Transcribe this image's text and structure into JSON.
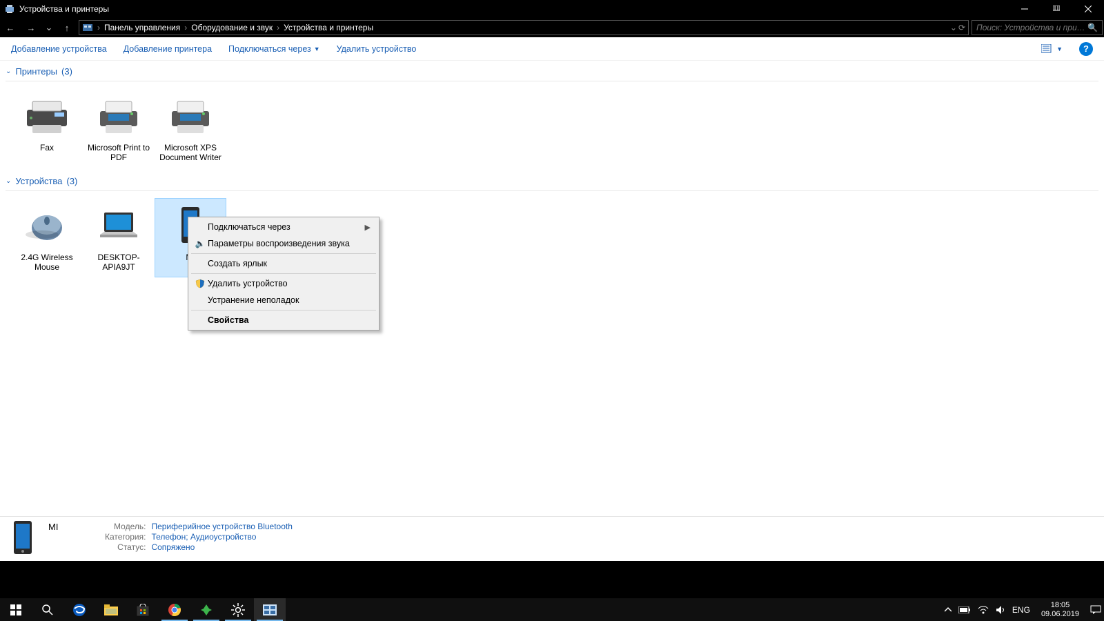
{
  "window_title": "Устройства и принтеры",
  "breadcrumbs": [
    "Панель управления",
    "Оборудование и звук",
    "Устройства и принтеры"
  ],
  "search_placeholder": "Поиск: Устройства и принте...",
  "toolbar": {
    "add_device": "Добавление устройства",
    "add_printer": "Добавление принтера",
    "connect_via": "Подключаться через",
    "remove_device": "Удалить устройство"
  },
  "groups": {
    "printers": {
      "title": "Принтеры",
      "count": "(3)"
    },
    "devices": {
      "title": "Устройства",
      "count": "(3)"
    }
  },
  "printers": [
    {
      "label": "Fax"
    },
    {
      "label": "Microsoft Print to PDF"
    },
    {
      "label": "Microsoft XPS Document Writer"
    }
  ],
  "devices": [
    {
      "label": "2.4G Wireless Mouse"
    },
    {
      "label": "DESKTOP-APIA9JT"
    },
    {
      "label": "MI"
    }
  ],
  "context_menu": {
    "connect_via": "Подключаться через",
    "sound_playback": "Параметры воспроизведения звука",
    "create_shortcut": "Создать ярлык",
    "remove_device": "Удалить устройство",
    "troubleshoot": "Устранение неполадок",
    "properties": "Свойства"
  },
  "details": {
    "name": "MI",
    "model_key": "Модель:",
    "model_val": "Периферийное устройство Bluetooth",
    "category_key": "Категория:",
    "category_val": "Телефон; Аудиоустройство",
    "status_key": "Статус:",
    "status_val": "Сопряжено"
  },
  "tray": {
    "lang": "ENG",
    "time": "18:05",
    "date": "09.06.2019"
  }
}
